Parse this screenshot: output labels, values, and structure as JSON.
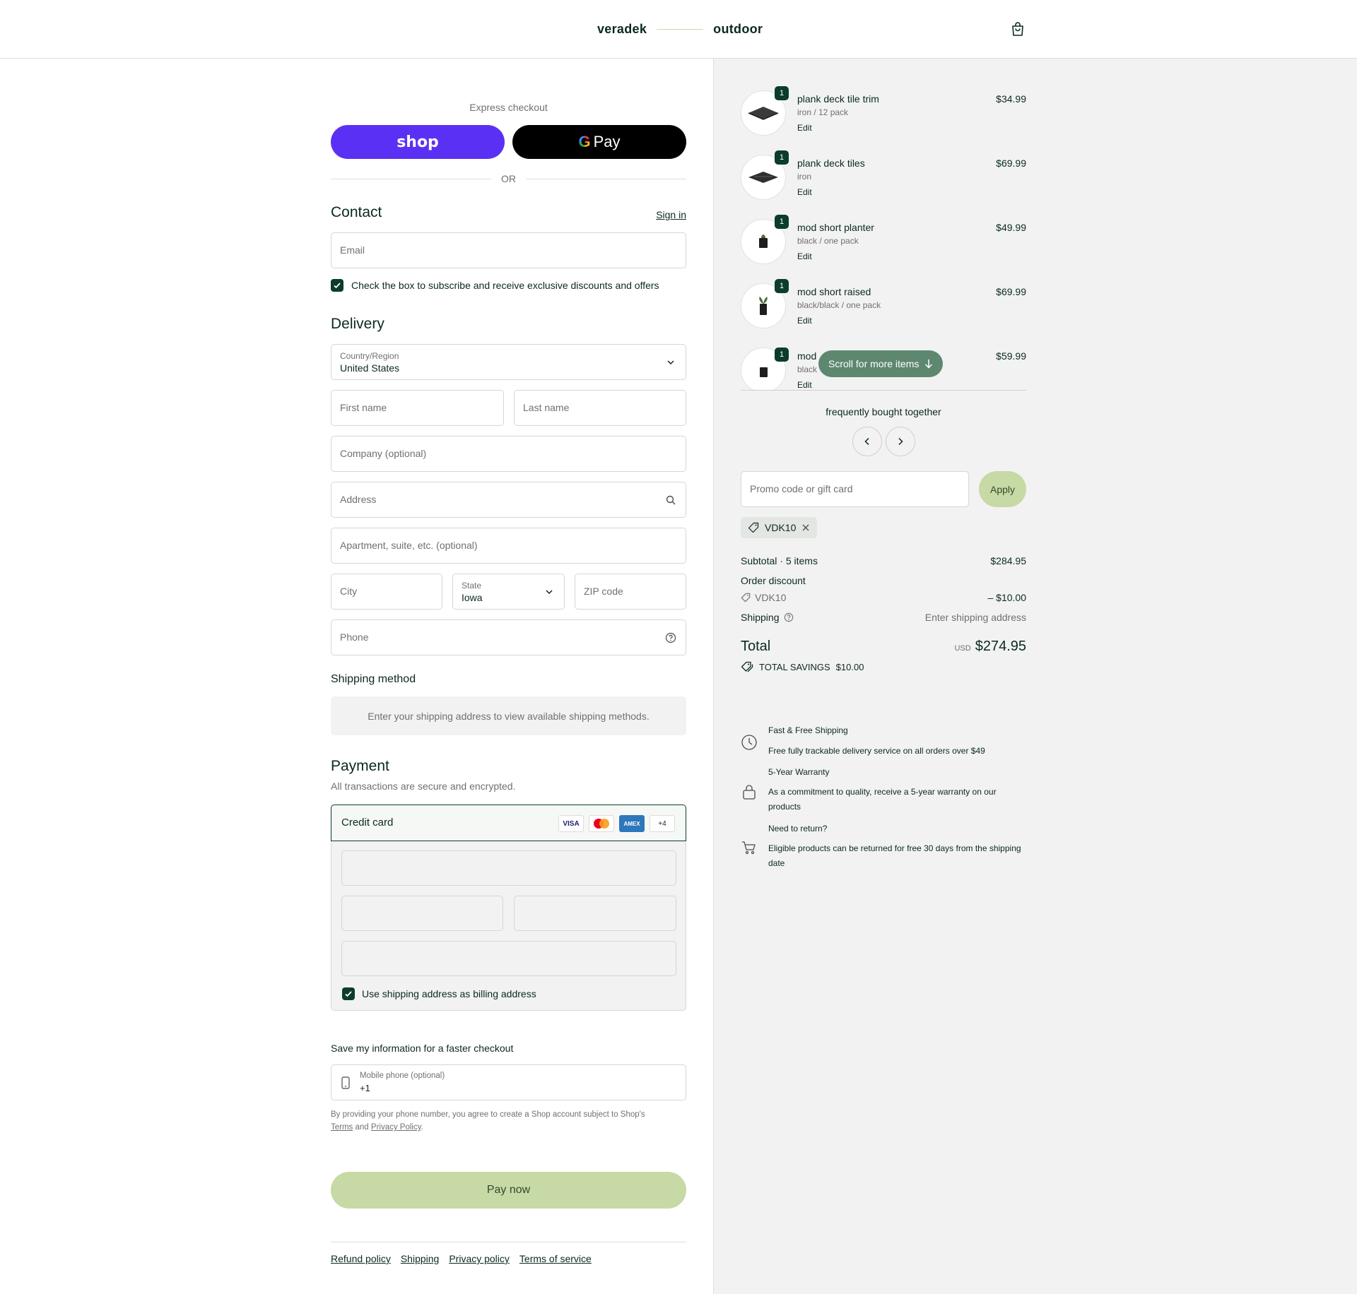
{
  "header": {
    "logo_left": "veradek",
    "logo_right": "outdoor"
  },
  "express": {
    "title": "Express checkout",
    "shop_label": "shop",
    "gpay_g": "G",
    "gpay_label": "Pay",
    "or_label": "OR"
  },
  "contact": {
    "title": "Contact",
    "sign_in": "Sign in",
    "email_placeholder": "Email",
    "subscribe_label": "Check the box to subscribe and receive exclusive discounts and offers"
  },
  "delivery": {
    "title": "Delivery",
    "country_label": "Country/Region",
    "country_value": "United States",
    "first_name": "First name",
    "last_name": "Last name",
    "company": "Company (optional)",
    "address": "Address",
    "apartment": "Apartment, suite, etc. (optional)",
    "city": "City",
    "state_label": "State",
    "state_value": "Iowa",
    "zip": "ZIP code",
    "phone": "Phone"
  },
  "shipping_method": {
    "title": "Shipping method",
    "message": "Enter your shipping address to view available shipping methods."
  },
  "payment": {
    "title": "Payment",
    "subtitle": "All transactions are secure and encrypted.",
    "credit_card": "Credit card",
    "cards": [
      "VISA",
      "MC",
      "AMEX",
      "+4"
    ],
    "billing_label": "Use shipping address as billing address"
  },
  "save_info": {
    "title": "Save my information for a faster checkout",
    "mobile_label": "Mobile phone (optional)",
    "mobile_value": "+1",
    "legal_text": "By providing your phone number, you agree to create a Shop account subject to Shop's",
    "terms": "Terms",
    "and": "and",
    "privacy": "Privacy Policy",
    "period": "."
  },
  "pay_now": "Pay now",
  "footer": {
    "links": [
      "Refund policy",
      "Shipping",
      "Privacy policy",
      "Terms of service"
    ]
  },
  "cart": {
    "items": [
      {
        "qty": "1",
        "name": "plank deck tile trim",
        "variant": "iron / 12 pack",
        "edit": "Edit",
        "price": "$34.99"
      },
      {
        "qty": "1",
        "name": "plank deck tiles",
        "variant": "iron",
        "edit": "Edit",
        "price": "$69.99"
      },
      {
        "qty": "1",
        "name": "mod short planter",
        "variant": "black / one pack",
        "edit": "Edit",
        "price": "$49.99"
      },
      {
        "qty": "1",
        "name": "mod short raised",
        "variant": "black/black / one pack",
        "edit": "Edit",
        "price": "$69.99"
      },
      {
        "qty": "1",
        "name": "mod",
        "variant": "black",
        "edit": "Edit",
        "price": "$59.99"
      }
    ],
    "scroll_hint": "Scroll for more items",
    "fbt_title": "frequently bought together",
    "promo_placeholder": "Promo code or gift card",
    "apply_label": "Apply",
    "applied_code": "VDK10"
  },
  "summary": {
    "subtotal_label": "Subtotal · 5 items",
    "subtotal_value": "$284.95",
    "discount_label": "Order discount",
    "discount_code": "VDK10",
    "discount_value": "– $10.00",
    "shipping_label": "Shipping",
    "shipping_value": "Enter shipping address",
    "total_label": "Total",
    "currency": "USD",
    "total_value": "$274.95",
    "savings_label": "TOTAL SAVINGS",
    "savings_value": "$10.00"
  },
  "perks": [
    {
      "title": "Fast & Free Shipping",
      "text": "Free fully trackable delivery service on all orders over $49"
    },
    {
      "title": "5-Year Warranty",
      "text": "As a commitment to quality, receive a 5-year warranty on our products"
    },
    {
      "title": "Need to return?",
      "text": "Eligible products can be returned for free 30 days from the shipping date"
    }
  ]
}
